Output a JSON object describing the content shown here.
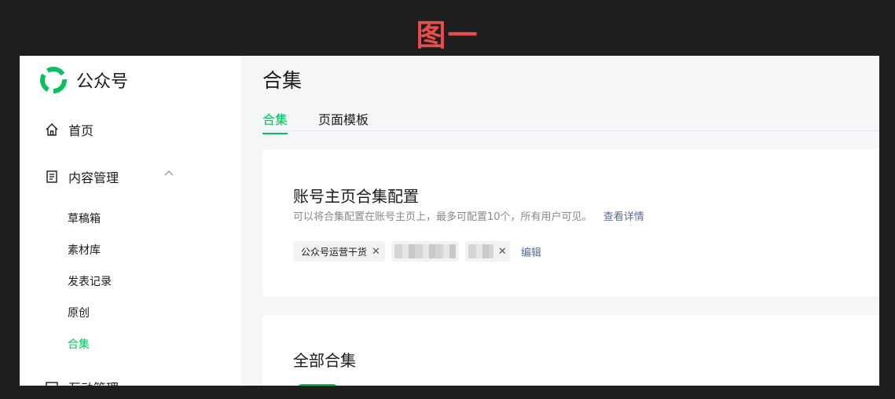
{
  "figure_label": "图一",
  "brand": {
    "name": "公众号",
    "logo_icon": "wechat-oa-logo-icon",
    "logo_color": "#07c160"
  },
  "sidebar": {
    "home": {
      "label": "首页",
      "icon": "home-icon"
    },
    "content": {
      "label": "内容管理",
      "icon": "document-icon",
      "expand_icon": "chevron-up-icon"
    },
    "sub_items": [
      {
        "label": "草稿箱"
      },
      {
        "label": "素材库"
      },
      {
        "label": "发表记录"
      },
      {
        "label": "原创"
      },
      {
        "label": "合集",
        "active": true
      }
    ],
    "next_section": {
      "label": "互动管理",
      "icon": "message-icon"
    }
  },
  "main": {
    "title": "合集",
    "tabs": [
      {
        "label": "合集",
        "active": true
      },
      {
        "label": "页面模板"
      }
    ],
    "config_card": {
      "title": "账号主页合集配置",
      "desc": "可以将合集配置在账号主页上，最多可配置10个，所有用户可见。",
      "detail_link": "查看详情",
      "tags": [
        {
          "label": "公众号运营干货"
        }
      ],
      "edit_link": "编辑"
    },
    "all_card": {
      "title": "全部合集"
    }
  },
  "colors": {
    "accent": "#07c160",
    "link": "#576b95",
    "figure_label": "#e84d4d"
  }
}
